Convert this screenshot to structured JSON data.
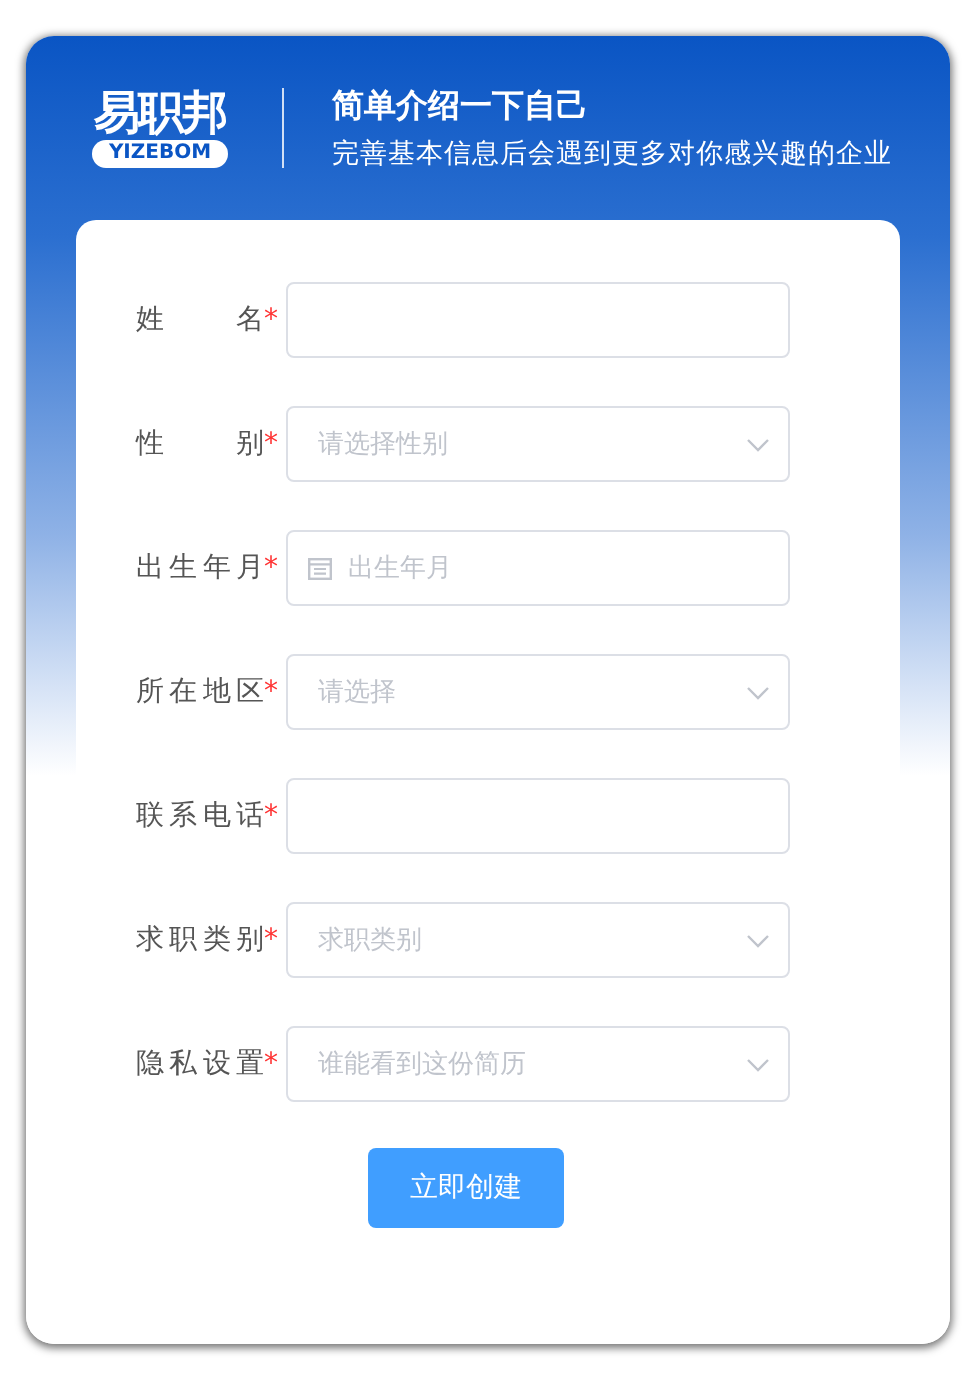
{
  "logo": {
    "name": "易职邦",
    "tagline": "YIZEBOM"
  },
  "header": {
    "title": "简单介绍一下自己",
    "subtitle": "完善基本信息后会遇到更多对你感兴趣的企业"
  },
  "fields": [
    {
      "label": "姓名",
      "required_mark": "*",
      "kind": "text"
    },
    {
      "label": "性别",
      "required_mark": "*",
      "kind": "select",
      "placeholder": "请选择性别"
    },
    {
      "label": "出生年月",
      "required_mark": "*",
      "kind": "date",
      "placeholder": "出生年月"
    },
    {
      "label": "所在地区",
      "required_mark": "*",
      "kind": "select",
      "placeholder": "请选择"
    },
    {
      "label": "联系电话",
      "required_mark": "*",
      "kind": "text"
    },
    {
      "label": "求职类别",
      "required_mark": "*",
      "kind": "select",
      "placeholder": "求职类别"
    },
    {
      "label": "隐私设置",
      "required_mark": "*",
      "kind": "select",
      "placeholder": "谁能看到这份简历"
    }
  ],
  "submit": "立即创建"
}
